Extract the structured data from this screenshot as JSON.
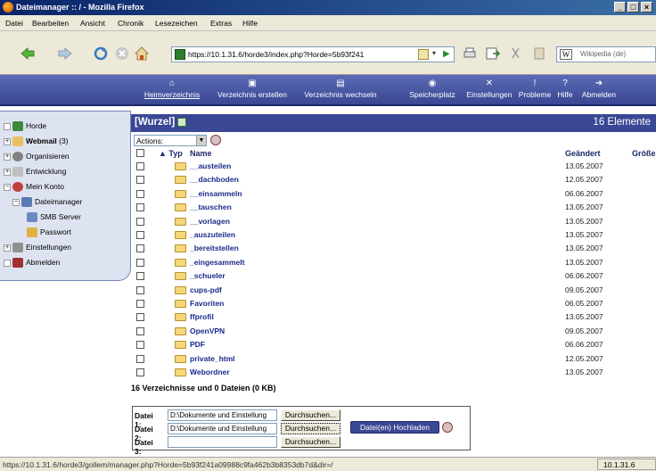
{
  "window": {
    "title": "Dateimanager :: / - Mozilla Firefox",
    "buttons": [
      "_",
      "□",
      "×"
    ]
  },
  "menubar": [
    "Datei",
    "Bearbeiten",
    "Ansicht",
    "Chronik",
    "Lesezeichen",
    "Extras",
    "Hilfe"
  ],
  "toolbar": {
    "url": "https://10.1.31.6/horde3/index.php?Horde=5b93f241",
    "search_engine": "W",
    "search_placeholder": "Wikipedia (de)"
  },
  "horde_nav": [
    {
      "label": "Heimverzeichnis",
      "icon": "home-icon",
      "active": true
    },
    {
      "label": "Verzeichnis erstellen",
      "icon": "new-folder-icon"
    },
    {
      "label": "Verzeichnis wechseln",
      "icon": "change-folder-icon"
    },
    {
      "label": "Speicherplatz",
      "icon": "quota-icon"
    },
    {
      "label": "Einstellungen",
      "icon": "settings-icon"
    },
    {
      "label": "Probleme",
      "icon": "problems-icon"
    },
    {
      "label": "Hilfe",
      "icon": "help-icon"
    },
    {
      "label": "Abmelden",
      "icon": "logout-icon"
    }
  ],
  "sidebar": {
    "items": [
      {
        "label": "Horde",
        "icon": "horde-icon"
      },
      {
        "label": "Webmail",
        "count": "(3)",
        "icon": "webmail-icon"
      },
      {
        "label": "Organisieren",
        "icon": "organize-icon"
      },
      {
        "label": "Entwicklung",
        "icon": "development-icon"
      },
      {
        "label": "Mein Konto",
        "icon": "account-icon"
      },
      {
        "label": "Dateimanager",
        "icon": "filemanager-icon"
      },
      {
        "label": "SMB Server",
        "icon": "smb-server-icon"
      },
      {
        "label": "Passwort",
        "icon": "password-icon"
      },
      {
        "label": "Einstellungen",
        "icon": "settings-icon"
      },
      {
        "label": "Abmelden",
        "icon": "logout-icon"
      }
    ]
  },
  "main": {
    "path": "[Wurzel]",
    "count": "16 Elemente",
    "actions_label": "Actions:",
    "columns": {
      "type": "▲ Typ",
      "name": "Name",
      "modified": "Geändert",
      "size": "Größe"
    },
    "rows": [
      {
        "name": "__austeilen",
        "date": "13.05.2007"
      },
      {
        "name": "__dachboden",
        "date": "12.05.2007"
      },
      {
        "name": "__einsammeln",
        "date": "06.06.2007"
      },
      {
        "name": "__tauschen",
        "date": "13.05.2007"
      },
      {
        "name": "__vorlagen",
        "date": "13.05.2007"
      },
      {
        "name": "_auszuteilen",
        "date": "13.05.2007"
      },
      {
        "name": "_bereitstellen",
        "date": "13.05.2007"
      },
      {
        "name": "_eingesammelt",
        "date": "13.05.2007"
      },
      {
        "name": "_schueler",
        "date": "06.06.2007"
      },
      {
        "name": "cups-pdf",
        "date": "09.05.2007"
      },
      {
        "name": "Favoriten",
        "date": "06.05.2007"
      },
      {
        "name": "ffprofil",
        "date": "13.05.2007"
      },
      {
        "name": "OpenVPN",
        "date": "09.05.2007"
      },
      {
        "name": "PDF",
        "date": "06.06.2007"
      },
      {
        "name": "private_html",
        "date": "12.05.2007"
      },
      {
        "name": "Webordner",
        "date": "13.05.2007"
      }
    ],
    "summary": "16 Verzeichnisse und 0 Dateien (0 KB)"
  },
  "upload": {
    "rows": [
      {
        "label": "Datei 1:",
        "value": "D:\\Dokumente und Einstellung",
        "button": "Durchsuchen..."
      },
      {
        "label": "Datei 2:",
        "value": "D:\\Dokumente und Einstellung",
        "button": "Durchsuchen..."
      },
      {
        "label": "Datei 3:",
        "value": "",
        "button": "Durchsuchen..."
      }
    ],
    "submit": "Datei(en) Hochladen"
  },
  "statusbar": {
    "url": "https://10.1.31.6/horde3/gollem/manager.php?Horde=5b93f241a09988c9fa462b3b8353db7d&dir=/",
    "host": "10.1.31.6"
  }
}
